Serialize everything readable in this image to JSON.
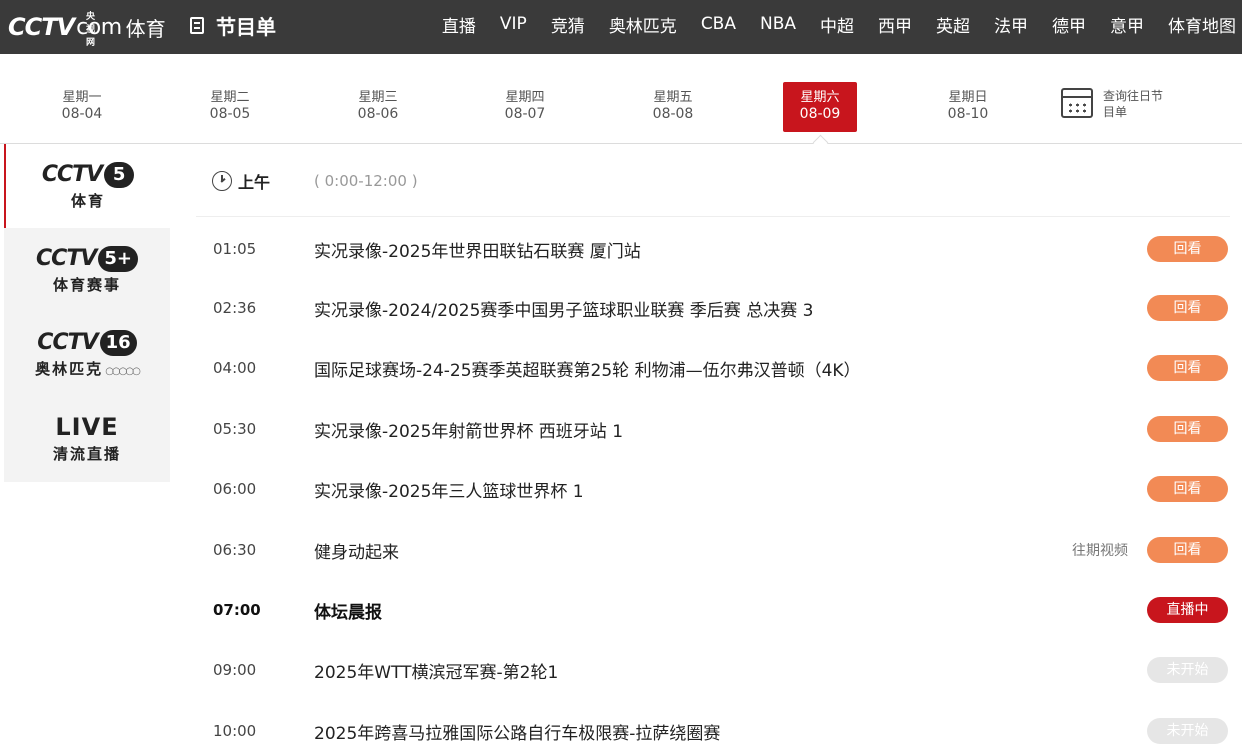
{
  "header": {
    "logo_text": "CCTV",
    "logo_small": "央视网",
    "logo_com": "com",
    "logo_sub": "体育",
    "page_title": "节目单",
    "nav": [
      "直播",
      "VIP",
      "竞猜",
      "奥林匹克",
      "CBA",
      "NBA",
      "中超",
      "西甲",
      "英超",
      "法甲",
      "德甲",
      "意甲",
      "体育地图"
    ]
  },
  "week": {
    "days": [
      {
        "weekday": "星期一",
        "date": "08-04"
      },
      {
        "weekday": "星期二",
        "date": "08-05"
      },
      {
        "weekday": "星期三",
        "date": "08-06"
      },
      {
        "weekday": "星期四",
        "date": "08-07"
      },
      {
        "weekday": "星期五",
        "date": "08-08"
      },
      {
        "weekday": "星期六",
        "date": "08-09"
      },
      {
        "weekday": "星期日",
        "date": "08-10"
      }
    ],
    "selected_index": 5,
    "history_label": "查询往日节目单"
  },
  "channels": [
    {
      "word": "CCTV",
      "badge": "5",
      "name": "体育"
    },
    {
      "word": "CCTV",
      "badge": "5+",
      "name": "体育赛事"
    },
    {
      "word": "CCTV",
      "badge": "16",
      "name": "奥林匹克"
    },
    {
      "word": "LIVE",
      "badge": "",
      "name": "清流直播"
    }
  ],
  "schedule": {
    "period_label": "上午",
    "period_range": "( 0:00-12:00 )",
    "programs": [
      {
        "time": "01:05",
        "title": "实况录像-2025年世界田联钻石联赛 厦门站",
        "extra": "",
        "status": "回看"
      },
      {
        "time": "02:36",
        "title": "实况录像-2024/2025赛季中国男子篮球职业联赛 季后赛 总决赛 3",
        "extra": "",
        "status": "回看"
      },
      {
        "time": "04:00",
        "title": "国际足球赛场-24-25赛季英超联赛第25轮 利物浦—伍尔弗汉普顿（4K）",
        "extra": "",
        "status": "回看"
      },
      {
        "time": "05:30",
        "title": "实况录像-2025年射箭世界杯 西班牙站 1",
        "extra": "",
        "status": "回看"
      },
      {
        "time": "06:00",
        "title": "实况录像-2025年三人篮球世界杯 1",
        "extra": "",
        "status": "回看"
      },
      {
        "time": "06:30",
        "title": "健身动起来",
        "extra": "往期视频",
        "status": "回看"
      },
      {
        "time": "07:00",
        "title": "体坛晨报",
        "extra": "",
        "status": "直播中"
      },
      {
        "time": "09:00",
        "title": "2025年WTT横滨冠军赛-第2轮1",
        "extra": "",
        "status": "未开始"
      },
      {
        "time": "10:00",
        "title": "2025年跨喜马拉雅国际公路自行车极限赛-拉萨绕圈赛",
        "extra": "",
        "status": "未开始"
      }
    ]
  },
  "colors": {
    "topbar": "#3a3a3a",
    "accent_red": "#c8151d",
    "replay_orange": "#f28a55",
    "upcoming_gray": "#e6e6e6"
  }
}
